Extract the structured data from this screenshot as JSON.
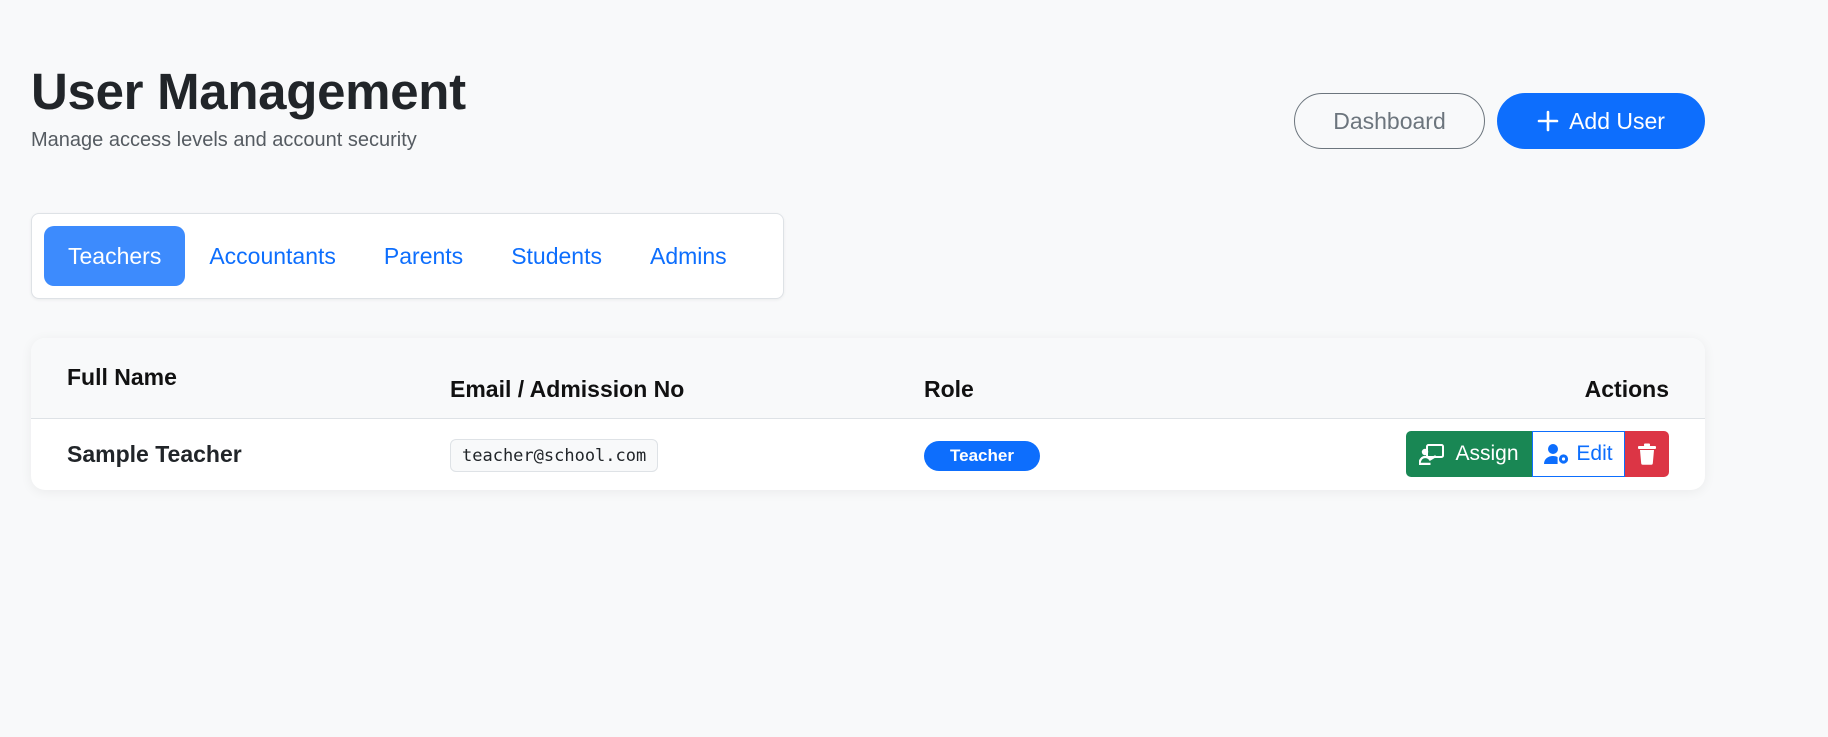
{
  "header": {
    "title": "User Management",
    "subtitle": "Manage access levels and account security",
    "dashboard_label": "Dashboard",
    "add_user_label": "Add User"
  },
  "tabs": [
    {
      "label": "Teachers",
      "active": true
    },
    {
      "label": "Accountants",
      "active": false
    },
    {
      "label": "Parents",
      "active": false
    },
    {
      "label": "Students",
      "active": false
    },
    {
      "label": "Admins",
      "active": false
    }
  ],
  "table": {
    "columns": [
      "Full Name",
      "Email / Admission No",
      "Role",
      "Actions"
    ],
    "rows": [
      {
        "name": "Sample Teacher",
        "email": "teacher@school.com",
        "role": "Teacher",
        "actions": {
          "assign_label": "Assign",
          "edit_label": "Edit"
        }
      }
    ]
  },
  "icons": {
    "add": "plus-icon",
    "assign": "chalkboard-teacher-icon",
    "edit": "user-gear-icon",
    "delete": "trash-icon"
  },
  "colors": {
    "primary": "#0d6efd",
    "active_tab": "#3d8bfd",
    "success": "#198754",
    "danger": "#dc3545",
    "background": "#f8f9fa"
  }
}
